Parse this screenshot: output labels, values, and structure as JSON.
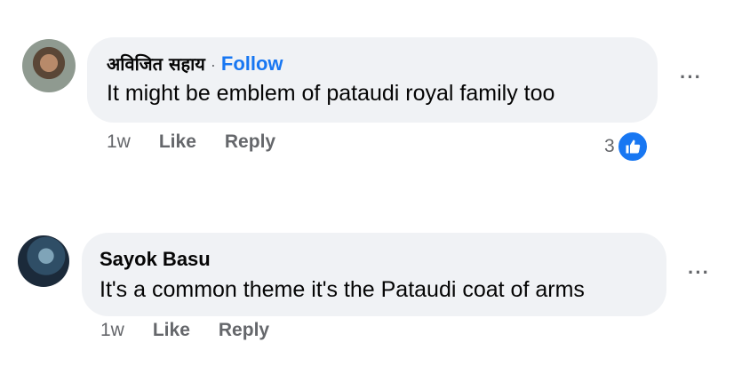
{
  "comments": [
    {
      "author": "अविजित सहाय",
      "separator": "·",
      "follow_label": "Follow",
      "text": "It might be emblem of pataudi royal family too",
      "time": "1w",
      "like_label": "Like",
      "reply_label": "Reply",
      "reaction_count": "3",
      "more_label": "···",
      "reaction_icon": "thumbs-up-icon",
      "accent_color": "#1877f2"
    },
    {
      "author": "Sayok Basu",
      "text": "It's a common theme it's the Pataudi coat of arms",
      "time": "1w",
      "like_label": "Like",
      "reply_label": "Reply",
      "more_label": "···"
    }
  ]
}
